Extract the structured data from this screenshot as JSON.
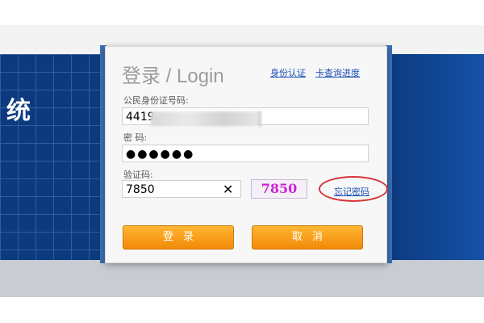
{
  "background": {
    "brand_char": "统",
    "colors": {
      "band": "#0d3a7e",
      "lower": "#c9ccd2"
    }
  },
  "login": {
    "title": "登录 / Login",
    "links": {
      "identity": "身份认证",
      "progress": "卡查询进度"
    },
    "id_field": {
      "label": "公民身份证号码:",
      "value": "4419"
    },
    "password_field": {
      "label": "密 码:",
      "value": "●●●●●●"
    },
    "captcha_field": {
      "label": "验证码:",
      "value": "7850",
      "clear_icon": "close-icon",
      "captcha_text": "7850"
    },
    "forgot_password": "忘记密码",
    "buttons": {
      "login": "登录",
      "cancel": "取消"
    },
    "colors": {
      "accent": "#f28a08",
      "link": "#1a4fb4",
      "highlight": "#d8323a",
      "captcha": "#d01fd8"
    }
  }
}
